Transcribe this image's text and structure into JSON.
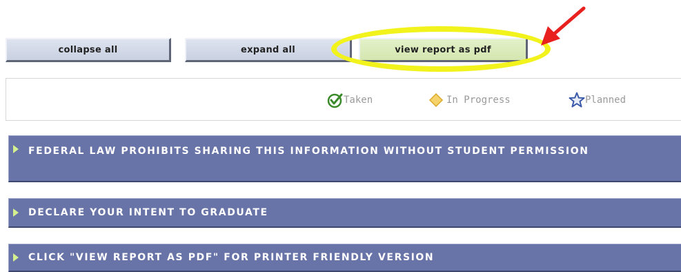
{
  "toolbar": {
    "collapse_label": "collapse all",
    "expand_label": "expand all",
    "pdf_label": "view report as pdf"
  },
  "legend": {
    "taken": {
      "label": "Taken",
      "icon": "check-circle-icon",
      "color": "#3a8a2a"
    },
    "in_progress": {
      "label": "In Progress",
      "icon": "diamond-icon",
      "color": "#f2c94a"
    },
    "planned": {
      "label": "Planned",
      "icon": "star-icon",
      "color": "#3b5aa8"
    }
  },
  "sections": [
    {
      "title": "FEDERAL LAW PROHIBITS SHARING THIS INFORMATION WITHOUT STUDENT PERMISSION"
    },
    {
      "title": "DECLARE YOUR INTENT TO GRADUATE"
    },
    {
      "title": "CLICK \"VIEW REPORT AS PDF\" FOR PRINTER FRIENDLY VERSION"
    }
  ],
  "annotation": {
    "highlight_color": "#f2f21c",
    "arrow_color": "#e8201e"
  },
  "colors": {
    "section_bg": "#6873a7",
    "pdf_button_bg": "#d9ebbb",
    "button_bg": "#d3d9e8"
  }
}
